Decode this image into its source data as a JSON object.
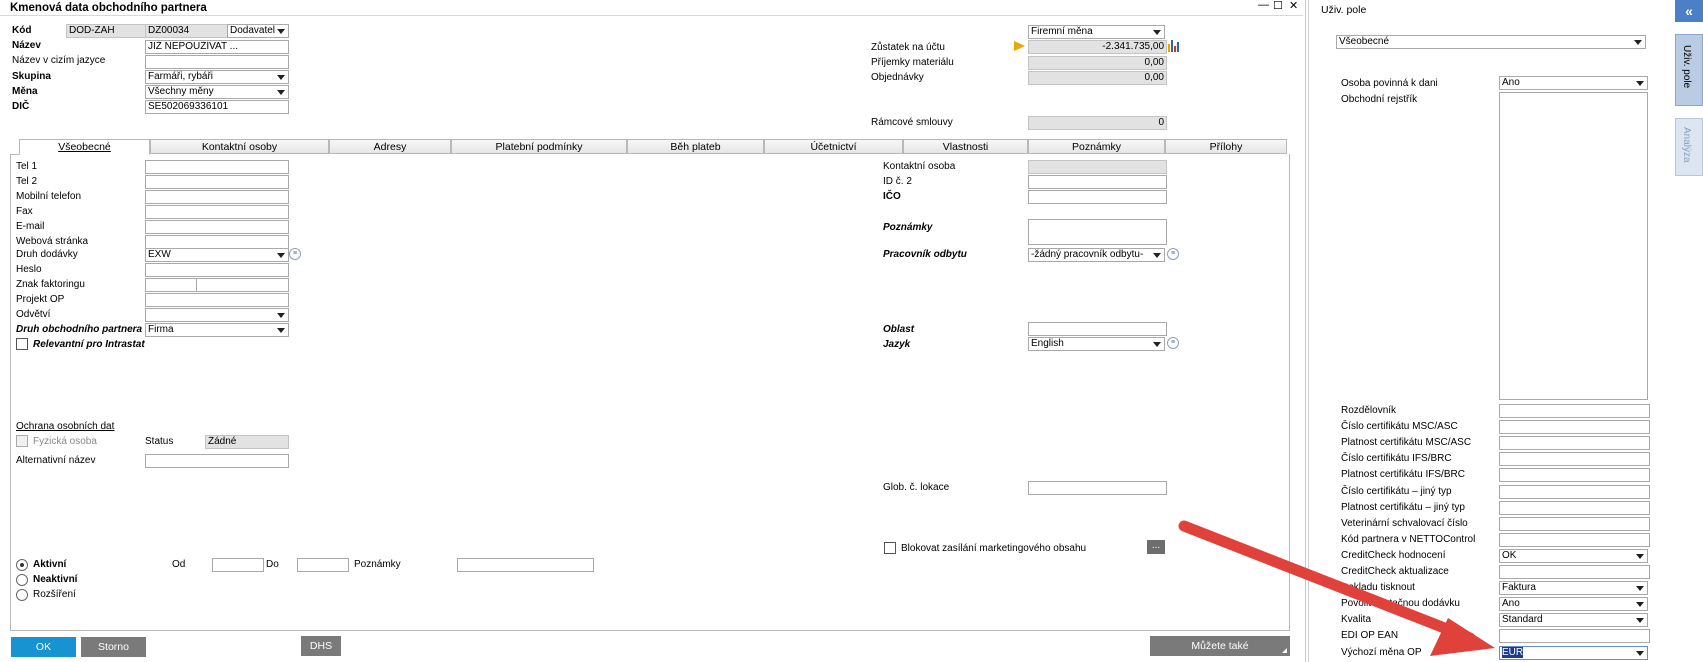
{
  "window": {
    "title": "Kmenová data obchodního partnera",
    "controls": {
      "minimize": "—",
      "maximize": "☐",
      "close": "✕"
    }
  },
  "header": {
    "kod_label": "Kód",
    "kod_series": "DOD-ZAH",
    "kod_value": "DZ00034",
    "kod_type": "Dodavatel",
    "nazev_label": "Název",
    "nazev_value": "JIŽ NEPOUŽÍVAT ...",
    "nazev_cizi_label": "Název v cizím jazyce",
    "nazev_cizi_value": "",
    "skupina_label": "Skupina",
    "skupina_value": "Farmáři, rybáři",
    "mena_label": "Měna",
    "mena_value": "Všechny měny",
    "dic_label": "DIČ",
    "dic_value": "SE502069336101"
  },
  "balances": {
    "currency_select": "Firemní měna",
    "zustatek_label": "Zůstatek na účtu",
    "zustatek_value": "-2.341.735,00",
    "prijemky_label": "Příjemky materiálu",
    "prijemky_value": "0,00",
    "objednavky_label": "Objednávky",
    "objednavky_value": "0,00",
    "ramcove_label": "Rámcové smlouvy",
    "ramcove_value": "0"
  },
  "tabs": [
    {
      "label": "Všeobecné",
      "active": true
    },
    {
      "label": "Kontaktní osoby"
    },
    {
      "label": "Adresy"
    },
    {
      "label": "Platební podmínky"
    },
    {
      "label": "Běh plateb"
    },
    {
      "label": "Účetnictví"
    },
    {
      "label": "Vlastnosti"
    },
    {
      "label": "Poznámky"
    },
    {
      "label": "Přílohy"
    }
  ],
  "general": {
    "tel1_label": "Tel 1",
    "tel2_label": "Tel 2",
    "mobil_label": "Mobilní telefon",
    "fax_label": "Fax",
    "email_label": "E-mail",
    "web_label": "Webová stránka",
    "druh_dodavky_label": "Druh dodávky",
    "druh_dodavky_value": "EXW",
    "heslo_label": "Heslo",
    "znak_label": "Znak faktoringu",
    "projekt_label": "Projekt OP",
    "odvetvi_label": "Odvětví",
    "druh_op_label": "Druh obchodního partnera",
    "druh_op_value": "Firma",
    "intrastat_label": "Relevantní pro Intrastat",
    "kontakt_label": "Kontaktní osoba",
    "id2_label": "ID č. 2",
    "ico_label": "IČO",
    "poznamky_label": "Poznámky",
    "pracovnik_label": "Pracovník odbytu",
    "pracovnik_value": "-žádný pracovník odbytu-",
    "oblast_label": "Oblast",
    "jazyk_label": "Jazyk",
    "jazyk_value": "English",
    "ochrana_label": "Ochrana osobních dat",
    "fyzicka_label": "Fyzická osoba",
    "status_label": "Status",
    "status_value": "Žádné",
    "alt_nazev_label": "Alternativní název",
    "glob_label": "Glob. č. lokace",
    "blokovat_label": "Blokovat zasílání marketingového obsahu",
    "dots_label": "..."
  },
  "status_section": {
    "aktivni": "Aktivní",
    "neaktivni": "Neaktivní",
    "rozsireni": "Rozšíření",
    "od": "Od",
    "do": "Do",
    "poznamky": "Poznámky"
  },
  "buttons": {
    "ok": "OK",
    "storno": "Storno",
    "dhs": "DHS",
    "muzete": "Můžete také"
  },
  "user_fields": {
    "title": "Uživ. pole",
    "category": "Všeobecné",
    "osoba_label": "Osoba povinná k dani",
    "osoba_value": "Ano",
    "rejstrik_label": "Obchodní rejstřík",
    "rows": [
      {
        "label": "Rozdělovník",
        "value": "",
        "type": "input"
      },
      {
        "label": "Číslo certifikátu MSC/ASC",
        "value": "",
        "type": "input"
      },
      {
        "label": "Platnost certifikátu MSC/ASC",
        "value": "",
        "type": "input"
      },
      {
        "label": "Číslo certifikátu IFS/BRC",
        "value": "",
        "type": "input"
      },
      {
        "label": "Platnost certifikátu IFS/BRC",
        "value": "",
        "type": "input"
      },
      {
        "label": "Číslo certifikátu – jiný typ",
        "value": "",
        "type": "input"
      },
      {
        "label": "Platnost certifikátu – jiný typ",
        "value": "",
        "type": "input"
      },
      {
        "label": "Veterinární schvalovací číslo",
        "value": "",
        "type": "input"
      },
      {
        "label": "Kód partnera v NETTOControl",
        "value": "",
        "type": "input"
      },
      {
        "label": "CreditCheck hodnocení",
        "value": "OK",
        "type": "select"
      },
      {
        "label": "CreditCheck aktualizace",
        "value": "",
        "type": "input"
      },
      {
        "label": "Dokladu tisknout",
        "value": "Faktura",
        "type": "select"
      },
      {
        "label": "Povolit částečnou dodávku",
        "value": "Ano",
        "type": "select"
      },
      {
        "label": "Kvalita",
        "value": "Standard",
        "type": "select"
      },
      {
        "label": "EDI OP EAN",
        "value": "",
        "type": "input"
      },
      {
        "label": "Výchozí měna OP",
        "value": "EUR",
        "type": "select"
      }
    ]
  },
  "side_tabs": {
    "active": "Uživ. pole",
    "inactive": "Analýza",
    "collapse": "«"
  },
  "colors": {
    "arrow": "#e0413a",
    "ok_button": "#1793d1",
    "gray_button": "#7a7a7a",
    "side_tab": "#b8cce4"
  }
}
